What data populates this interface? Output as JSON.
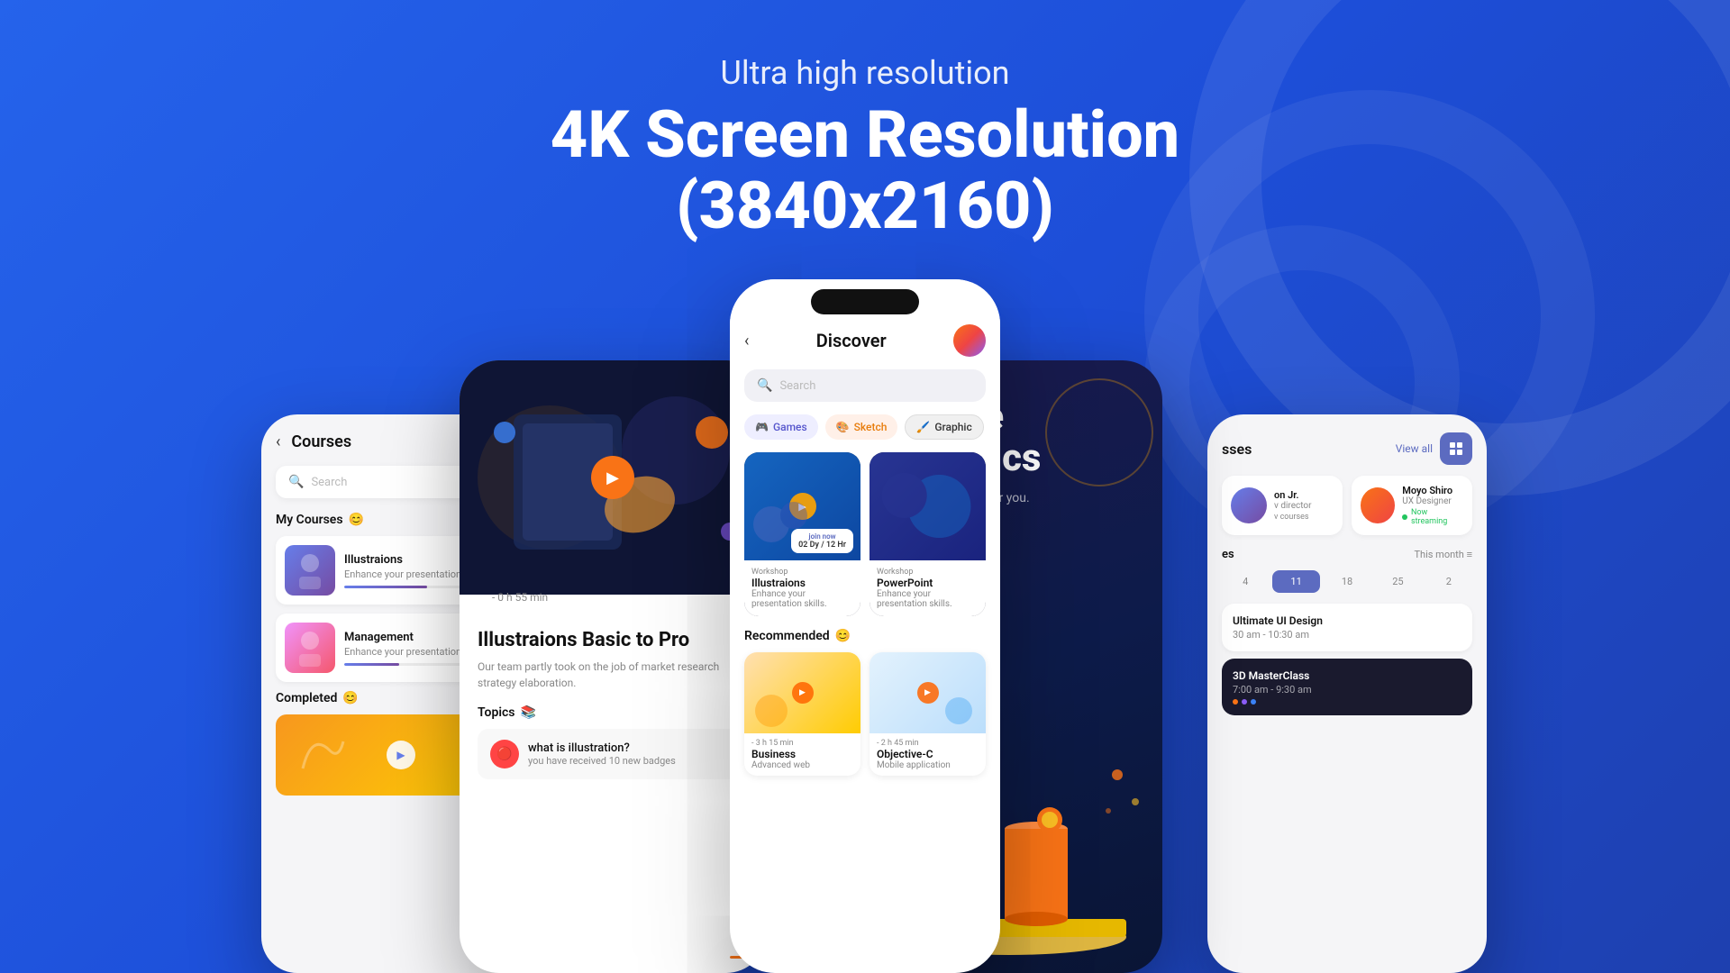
{
  "background": {
    "gradient_start": "#2563eb",
    "gradient_end": "#1e40af"
  },
  "header": {
    "subtitle": "Ultra high resolution",
    "title_line1": "4K Screen Resolution",
    "title_line2": "(3840x2160)"
  },
  "phone_left": {
    "title": "Courses",
    "search_placeholder": "Search",
    "my_courses_label": "My Courses",
    "my_courses_emoji": "😊",
    "courses": [
      {
        "name": "Illustraions",
        "desc": "Enhance your presentation sk...",
        "progress": 60
      },
      {
        "name": "Management",
        "desc": "Enhance your presentation sk...",
        "progress": 40
      }
    ],
    "completed_label": "Completed",
    "completed_emoji": "😊"
  },
  "phone_center_left": {
    "duration": "- 0 h 55 min",
    "title": "Illustraions Basic to Pro",
    "desc": "Our team partly took on the job of market research strategy elaboration.",
    "topics_label": "Topics",
    "topics_emoji": "📚",
    "topic_name": "what is illustration?",
    "topic_sub": "you have received 10 new badges"
  },
  "phone_center": {
    "title": "Discover",
    "search_placeholder": "Search",
    "categories": [
      {
        "label": "Games",
        "icon": "🎮",
        "style": "games"
      },
      {
        "label": "Sketch",
        "icon": "🎨",
        "style": "sketch"
      },
      {
        "label": "Graphic",
        "icon": "🖌️",
        "style": "graphic"
      }
    ],
    "cards": [
      {
        "type": "Workshop",
        "title": "Illustraions",
        "desc": "Enhance your presentation skills.",
        "join_label": "join now",
        "join_time": "02 Dy / 12 Hr"
      },
      {
        "type": "Workshop",
        "title": "PowerPoint",
        "desc": "Enhance your presentation skills."
      }
    ],
    "recommended_label": "Recommended",
    "recommended_emoji": "😊",
    "rec_cards": [
      {
        "duration": "- 3 h 15 min",
        "title": "Business",
        "sub": "Advanced web"
      },
      {
        "duration": "- 2 h 45 min",
        "title": "Objective-C",
        "sub": "Mobile application"
      }
    ]
  },
  "phone_analytics": {
    "title_line1": "Google",
    "title_line2": "Analytics",
    "subtitle": "See what's in it for you."
  },
  "phone_right": {
    "title": "sses",
    "view_all": "View all",
    "instructors": [
      {
        "name": "on Jr.",
        "role": "v director",
        "courses": "v courses"
      },
      {
        "name": "Moyo Shiro",
        "role": "UX Designer",
        "streaming": true
      }
    ],
    "schedule_title": "es",
    "this_month": "This month",
    "calendar_days": [
      "4",
      "11",
      "18",
      "25",
      "2"
    ],
    "events": [
      {
        "title": "Ultimate UI Design",
        "time": "30 am - 10:30 am"
      },
      {
        "title": "3D MasterClass",
        "time": "7:00 am - 9:30 am",
        "dark": true
      }
    ]
  }
}
